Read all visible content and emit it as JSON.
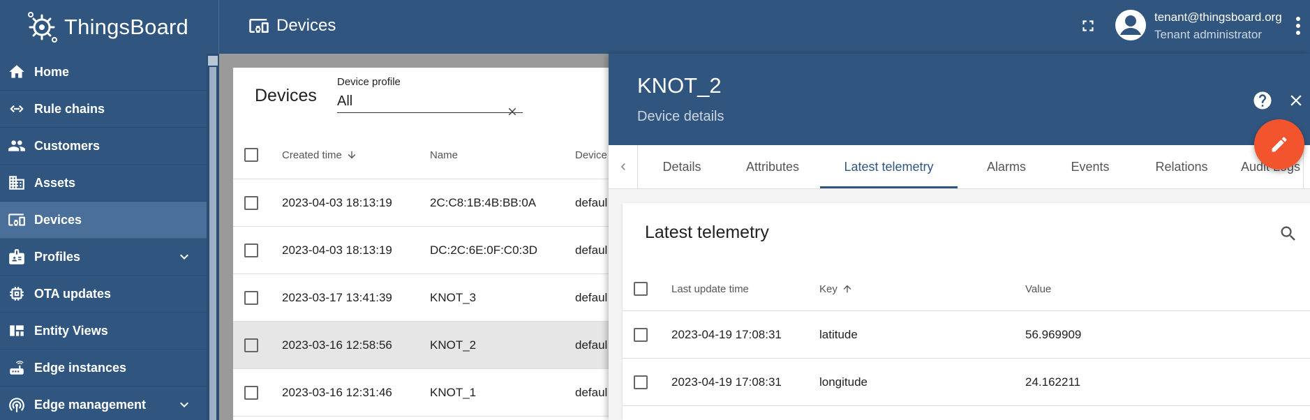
{
  "app": {
    "brand": "ThingsBoard",
    "page_title": "Devices",
    "user_email": "tenant@thingsboard.org",
    "user_role": "Tenant administrator",
    "brand_color": "#305680",
    "accent_color": "#f2542d"
  },
  "sidebar": {
    "items": [
      {
        "label": "Home",
        "icon": "home-icon"
      },
      {
        "label": "Rule chains",
        "icon": "rule-chains-icon"
      },
      {
        "label": "Customers",
        "icon": "customers-icon"
      },
      {
        "label": "Assets",
        "icon": "assets-icon"
      },
      {
        "label": "Devices",
        "icon": "devices-icon",
        "active": true
      },
      {
        "label": "Profiles",
        "icon": "profiles-icon",
        "expandable": true
      },
      {
        "label": "OTA updates",
        "icon": "ota-updates-icon"
      },
      {
        "label": "Entity Views",
        "icon": "entity-views-icon"
      },
      {
        "label": "Edge instances",
        "icon": "edge-instances-icon"
      },
      {
        "label": "Edge management",
        "icon": "edge-management-icon",
        "expandable": true
      }
    ]
  },
  "devices": {
    "title": "Devices",
    "filter_label": "Device profile",
    "filter_value": "All",
    "columns": [
      "Created time",
      "Name",
      "Device"
    ],
    "rows": [
      {
        "created": "2023-04-03 18:13:19",
        "name": "2C:C8:1B:4B:BB:0A",
        "profile": "defaul"
      },
      {
        "created": "2023-04-03 18:13:19",
        "name": "DC:2C:6E:0F:C0:3D",
        "profile": "defaul"
      },
      {
        "created": "2023-03-17 13:41:39",
        "name": "KNOT_3",
        "profile": "defaul"
      },
      {
        "created": "2023-03-16 12:58:56",
        "name": "KNOT_2",
        "profile": "defaul",
        "selected": true
      },
      {
        "created": "2023-03-16 12:31:46",
        "name": "KNOT_1",
        "profile": "defaul"
      }
    ]
  },
  "details": {
    "entity_name": "KNOT_2",
    "subtitle": "Device details",
    "tabs": [
      "Details",
      "Attributes",
      "Latest telemetry",
      "Alarms",
      "Events",
      "Relations",
      "Audit Logs"
    ],
    "active_tab": "Latest telemetry",
    "telemetry": {
      "title": "Latest telemetry",
      "columns": [
        "Last update time",
        "Key",
        "Value"
      ],
      "rows": [
        {
          "time": "2023-04-19 17:08:31",
          "key": "latitude",
          "value": "56.969909"
        },
        {
          "time": "2023-04-19 17:08:31",
          "key": "longitude",
          "value": "24.162211"
        }
      ]
    }
  }
}
